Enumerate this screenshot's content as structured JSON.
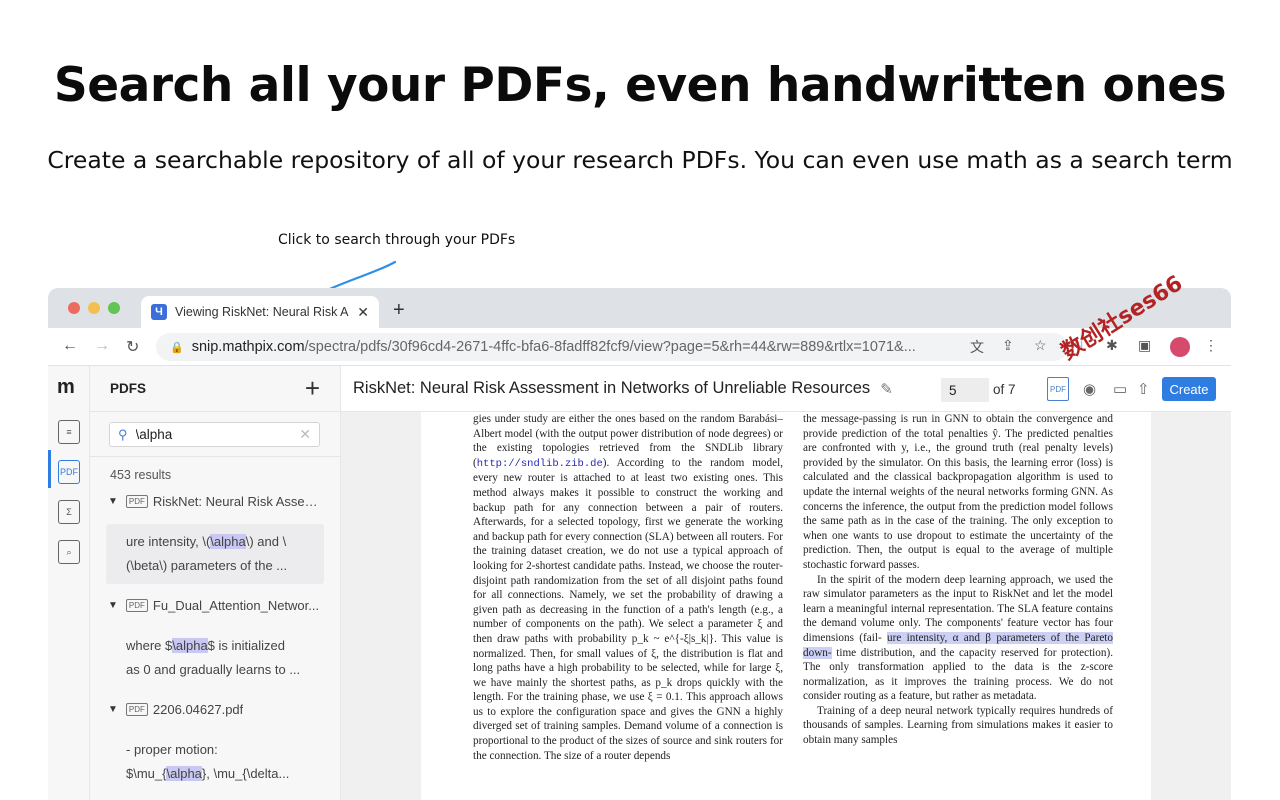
{
  "hero": {
    "title": "Search all your PDFs, even handwritten ones",
    "subtitle": "Create a searchable repository of all of your research PDFs. You can even use math as a search term",
    "callout": "Click to search through your PDFs"
  },
  "browser": {
    "tab_title": "Viewing RiskNet: Neural Risk A",
    "url_host": "snip.mathpix.com",
    "url_path": "/spectra/pdfs/30f96cd4-2671-4ffc-bfa6-8fadff82fcf9/view?page=5&rh=44&rw=889&rtlx=1071&..."
  },
  "sidebar": {
    "title": "PDFS",
    "add_label": "+",
    "search_value": "\\alpha",
    "results_count": "453 results",
    "documents": [
      {
        "title": "RiskNet: Neural Risk Assess...",
        "snippet_l1_pre": "ure intensity, \\(",
        "snippet_l1_hl": "\\alpha",
        "snippet_l1_post": "\\) and \\",
        "snippet_l2": "(\\beta\\) parameters of the ..."
      },
      {
        "title": "Fu_Dual_Attention_Networ...",
        "snippet_l1_pre": "where $",
        "snippet_l1_hl": "\\alpha",
        "snippet_l1_post": "$ is initialized",
        "snippet_l2": "as 0 and gradually learns to ..."
      },
      {
        "title": "2206.04627.pdf",
        "snippet_l1_pre": "- proper motion:",
        "snippet_l1_hl": "",
        "snippet_l1_post": "",
        "snippet_l2_pre": "$\\mu_{",
        "snippet_l2_hl": "\\alpha",
        "snippet_l2_post": "}, \\mu_{\\delta..."
      }
    ]
  },
  "viewer": {
    "doc_title": "RiskNet: Neural Risk Assessment in Networks of Unreliable Resources",
    "page_value": "5",
    "page_of": "of 7",
    "create_label": "Create",
    "watermark": "数创社ses66"
  },
  "page_text": {
    "left": [
      "gies under study are either the ones based on the random Barabási–Albert model (with the output power distribution of node degrees) or the existing topologies retrieved from the SNDLib library (",
      "http://sndlib.zib.de",
      "). According to the random model, every new router is attached to at least two existing ones. This method always makes it possible to construct the working and backup path for any connection between a pair of routers. Afterwards, for a selected topology, first we generate the working and backup path for every connection (SLA) between all routers. For the training dataset creation, we do not use a typical approach of looking for 2-shortest candidate paths. Instead, we choose the router-disjoint path randomization from the set of all disjoint paths found for all connections. Namely, we set the probability of drawing a given path as decreasing in the function of a path's length (e.g., a number of components on the path). We select a parameter ξ and then draw paths with probability p_k ~ e^{-ξ|s_k|}. This value is normalized. Then, for small values of ξ, the distribution is flat and long paths have a high probability to be selected, while for large ξ, we have mainly the shortest paths, as p_k drops quickly with the length. For the training phase, we use ξ = 0.1. This approach allows us to explore the configuration space and gives the GNN a highly diverged set of training samples. Demand volume of a connection is proportional to the product of the sizes of source and sink routers for the connection. The size of a router depends"
    ],
    "right_p1": "the message-passing is run in GNN to obtain the convergence and provide prediction of the total penalties ŷ. The predicted penalties are confronted with y, i.e., the ground truth (real penalty levels) provided by the simulator. On this basis, the learning error (loss) is calculated and the classical backpropagation algorithm is used to update the internal weights of the neural networks forming GNN. As concerns the inference, the output from the prediction model follows the same path as in the case of the training. The only exception to when one wants to use dropout to estimate the uncertainty of the prediction. Then, the output is equal to the average of multiple stochastic forward passes.",
    "right_p2_pre": "In the spirit of the modern deep learning approach, we used the raw simulator parameters as the input to RiskNet and let the model learn a meaningful internal representation. The SLA feature contains the demand volume only. The components' feature vector has four dimensions (fail-",
    "right_p2_hl": "ure intensity, α and β parameters of the Pareto down-",
    "right_p2_post": "time distribution, and the capacity reserved for protection). The only transformation applied to the data is the z-score normalization, as it improves the training process. We do not consider routing as a feature, but rather as metadata.",
    "right_p3": "Training of a deep neural network typically requires hundreds of thousands of samples. Learning from simulations makes it easier to obtain many samples"
  }
}
